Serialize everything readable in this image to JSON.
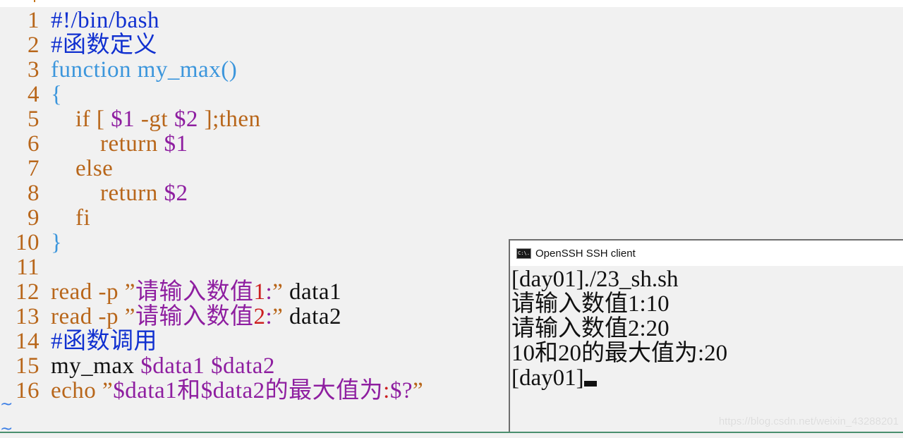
{
  "editor": {
    "lines": [
      {
        "n": "1",
        "segments": [
          {
            "t": "#!/bin/bash",
            "c": "comment"
          }
        ]
      },
      {
        "n": "2",
        "segments": [
          {
            "t": "#函数定义",
            "c": "comment"
          }
        ]
      },
      {
        "n": "3",
        "segments": [
          {
            "t": "function my_max()",
            "c": "func"
          }
        ]
      },
      {
        "n": "4",
        "segments": [
          {
            "t": "{",
            "c": "func"
          }
        ]
      },
      {
        "n": "5",
        "segments": [
          {
            "t": "    if [ ",
            "c": "kw"
          },
          {
            "t": "$1",
            "c": "var"
          },
          {
            "t": " -gt ",
            "c": "kw"
          },
          {
            "t": "$2",
            "c": "var"
          },
          {
            "t": " ];then",
            "c": "kw"
          }
        ]
      },
      {
        "n": "6",
        "segments": [
          {
            "t": "        return ",
            "c": "kw"
          },
          {
            "t": "$1",
            "c": "var"
          }
        ]
      },
      {
        "n": "7",
        "segments": [
          {
            "t": "    else",
            "c": "kw"
          }
        ]
      },
      {
        "n": "8",
        "segments": [
          {
            "t": "        return ",
            "c": "kw"
          },
          {
            "t": "$2",
            "c": "var"
          }
        ]
      },
      {
        "n": "9",
        "segments": [
          {
            "t": "    fi",
            "c": "kw"
          }
        ]
      },
      {
        "n": "10",
        "segments": [
          {
            "t": "}",
            "c": "func"
          }
        ]
      },
      {
        "n": "11",
        "segments": []
      },
      {
        "n": "12",
        "segments": [
          {
            "t": "read -p ",
            "c": "kw"
          },
          {
            "t": "”",
            "c": "kw"
          },
          {
            "t": "请输入数值",
            "c": "str"
          },
          {
            "t": "1",
            "c": "num"
          },
          {
            "t": ":",
            "c": "str"
          },
          {
            "t": "”",
            "c": "kw"
          },
          {
            "t": " data1",
            "c": "plain"
          }
        ]
      },
      {
        "n": "13",
        "segments": [
          {
            "t": "read -p ",
            "c": "kw"
          },
          {
            "t": "”",
            "c": "kw"
          },
          {
            "t": "请输入数值",
            "c": "str"
          },
          {
            "t": "2",
            "c": "num"
          },
          {
            "t": ":",
            "c": "str"
          },
          {
            "t": "”",
            "c": "kw"
          },
          {
            "t": " data2",
            "c": "plain"
          }
        ]
      },
      {
        "n": "14",
        "segments": [
          {
            "t": "#函数调用",
            "c": "comment"
          }
        ]
      },
      {
        "n": "15",
        "segments": [
          {
            "t": "my_max ",
            "c": "plain"
          },
          {
            "t": "$data1 $data2",
            "c": "var"
          }
        ]
      },
      {
        "n": "16",
        "segments": [
          {
            "t": "echo ",
            "c": "kw"
          },
          {
            "t": "”",
            "c": "kw"
          },
          {
            "t": "$data1和$data2的最大值为",
            "c": "str"
          },
          {
            "t": ":",
            "c": "num"
          },
          {
            "t": "$?",
            "c": "str"
          },
          {
            "t": "”",
            "c": "kw"
          }
        ]
      }
    ],
    "tilde_marker": "~"
  },
  "terminal": {
    "title": "OpenSSH SSH client",
    "icon": "console-icon",
    "icon_text": "C:\\.",
    "lines": [
      "[day01]./23_sh.sh",
      "请输入数值1:10",
      "请输入数值2:20",
      "10和20的最大值为:20",
      "[day01]"
    ]
  },
  "watermark": "https://blog.csdn.net/weixin_43288201"
}
